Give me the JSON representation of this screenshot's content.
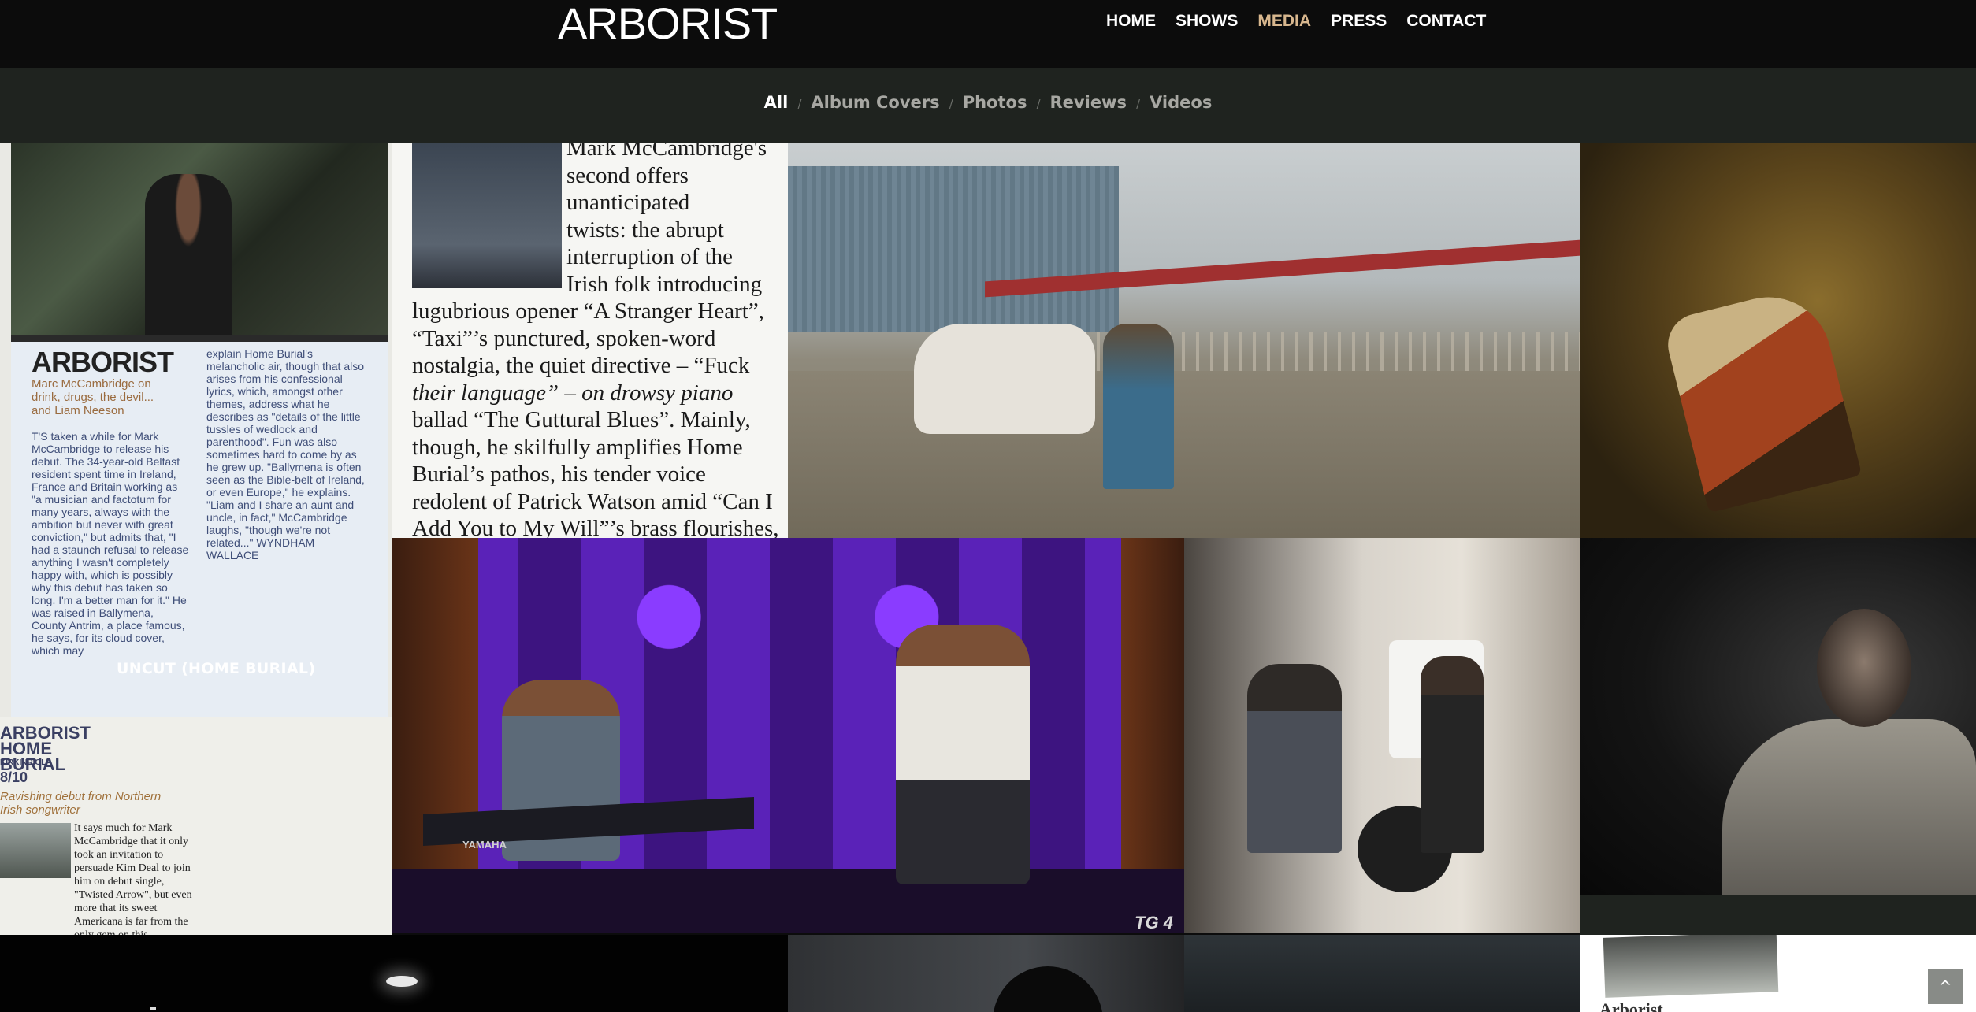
{
  "header": {
    "logo": "ARBORIST",
    "nav": [
      {
        "label": "HOME"
      },
      {
        "label": "SHOWS"
      },
      {
        "label": "MEDIA",
        "active": true
      },
      {
        "label": "PRESS"
      },
      {
        "label": "CONTACT"
      }
    ],
    "active_color": "#d8b78e"
  },
  "filters": {
    "items": [
      "All",
      "Album Covers",
      "Photos",
      "Reviews",
      "Videos"
    ],
    "active": "All",
    "separator": "/"
  },
  "gallery": {
    "tile1": {
      "caption": "UNCUT (HOME BURIAL)",
      "headline": "ARBORIST",
      "sub": "Marc McCambridge on drink, drugs, the devil... and Liam Neeson",
      "col1": "T'S taken a while for Mark McCambridge to release his debut. The 34-year-old Belfast resident spent time in Ireland, France and Britain working as \"a musician and factotum for many years, always with the ambition but never with great conviction,\" but admits that, \"I had a staunch refusal to release anything I wasn't completely happy with, which is possibly why this debut has taken so long. I'm a better man for it.\" He was raised in Ballymena, County Antrim, a place famous, he says, for its cloud cover, which may",
      "col2": "explain Home Burial's melancholic air, though that also arises from his confessional lyrics, which, amongst other themes, address what he describes as \"details of the little tussles of wedlock and parenthood\". Fun was also sometimes hard to come by as he grew up. \"Ballymena is often seen as the Bible-belt of Ireland, or even Europe,\" he explains. \"Liam and I share an aunt and uncle, in fact,\" McCambridge laughs, \"though we're not related...\" WYNDHAM WALLACE",
      "review_title": "ARBORIST HOME BURIAL",
      "review_label": "KIRKINRIOLA",
      "review_score": "8/10",
      "review_sub": "Ravishing debut from Northern Irish songwriter",
      "review_text": "It says much for Mark McCambridge that it only took an invitation to persuade Kim Deal to join him on debut single, \"Twisted Arrow\", but even more that its sweet Americana is far from the only gem on this deliciously"
    },
    "tile2": {
      "lines_narrow": [
        "Mark McCambridge's",
        "second offers",
        "unanticipated",
        "twists: the abrupt",
        "interruption of the",
        "Irish folk introducing"
      ],
      "lines_wide": [
        "lugubrious opener “A Stranger Heart”,",
        "“Taxi”’s punctured, spoken-word",
        "nostalgia, the quiet directive – “Fuck",
        "their language” – on drowsy piano",
        "ballad “The Guttural Blues”. Mainly,",
        "though, he skilfully amplifies Home",
        "Burial’s pathos, his tender voice",
        "redolent of Patrick Watson amid “Can I",
        "Add You to My Will”’s brass flourishes,"
      ]
    },
    "tile5": {
      "watermark": "TG 4",
      "keyboard_brand": "YAMAHA"
    },
    "tile11": {
      "word": "Arborist"
    }
  },
  "back_to_top": {
    "label": "^"
  }
}
